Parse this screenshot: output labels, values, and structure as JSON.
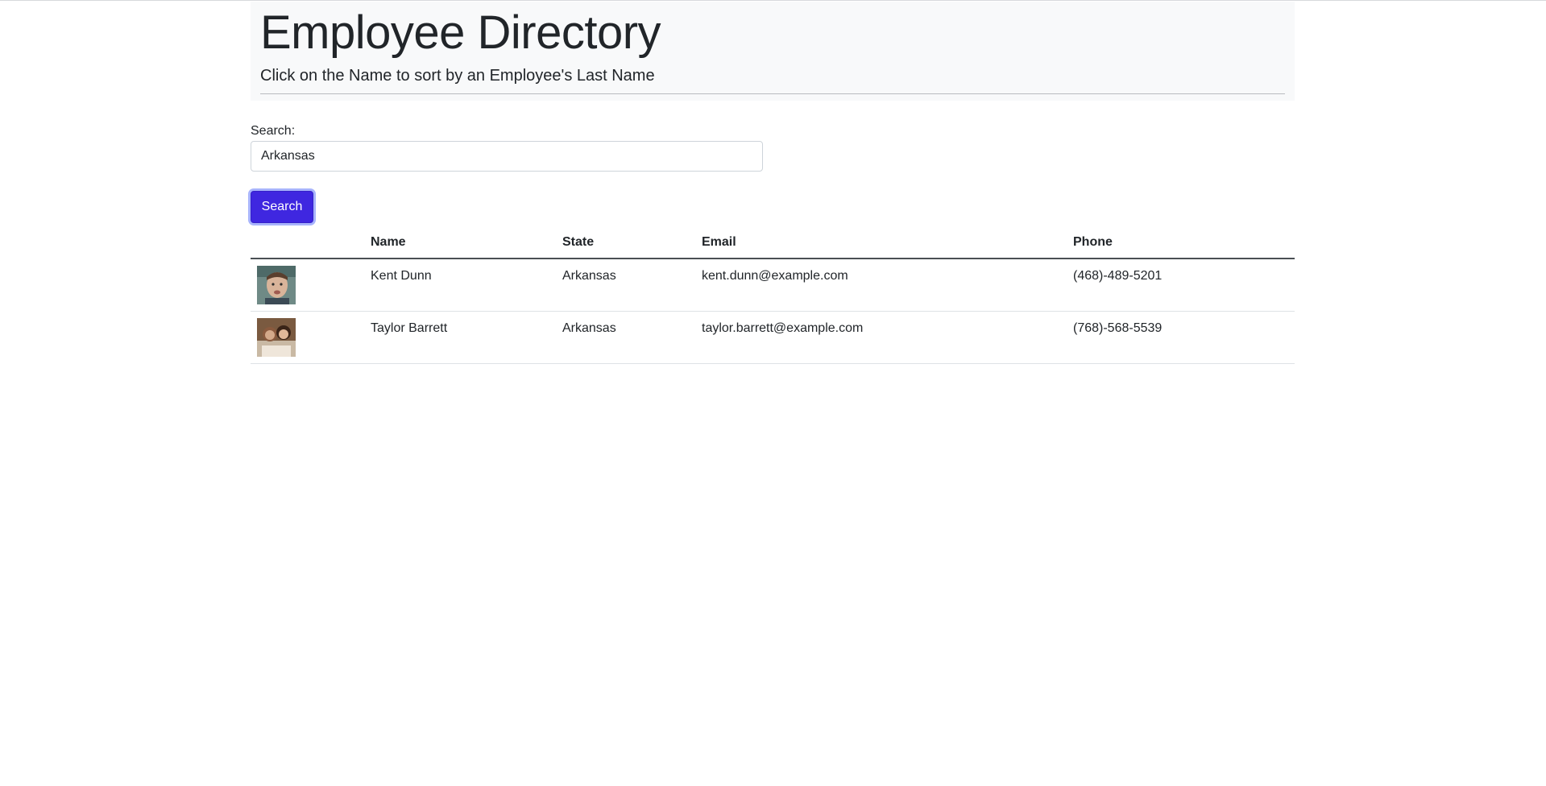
{
  "header": {
    "title": "Employee Directory",
    "subtitle": "Click on the Name to sort by an Employee's Last Name"
  },
  "search": {
    "label": "Search:",
    "value": "Arkansas",
    "button_label": "Search"
  },
  "table": {
    "columns": [
      "",
      "Name",
      "State",
      "Email",
      "Phone"
    ],
    "rows": [
      {
        "name": "Kent Dunn",
        "state": "Arkansas",
        "email": "kent.dunn@example.com",
        "phone": "(468)-489-5201",
        "avatar_icon": "person-portrait-icon"
      },
      {
        "name": "Taylor Barrett",
        "state": "Arkansas",
        "email": "taylor.barrett@example.com",
        "phone": "(768)-568-5539",
        "avatar_icon": "person-portrait-icon"
      }
    ]
  },
  "colors": {
    "accent": "#3f27e0",
    "jumbotron_bg": "#f8f9fa"
  }
}
